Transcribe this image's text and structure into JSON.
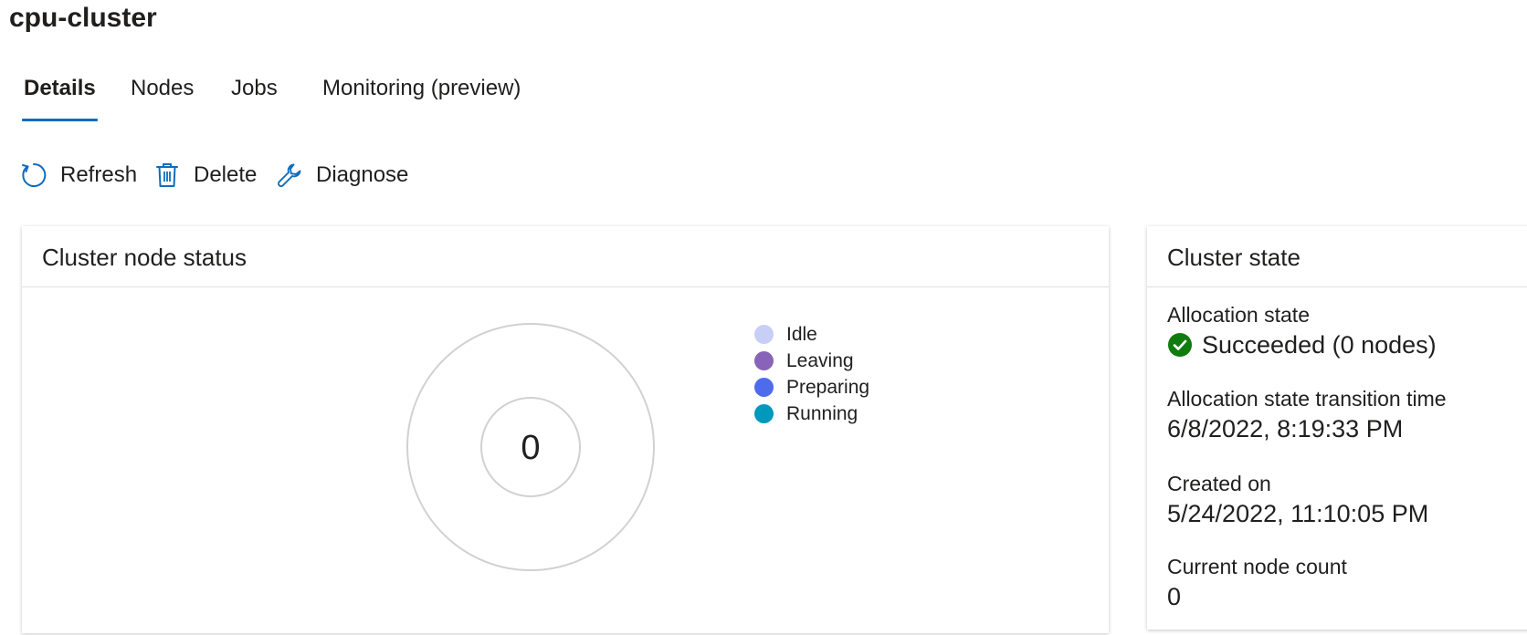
{
  "page": {
    "title": "cpu-cluster"
  },
  "tabs": [
    {
      "label": "Details",
      "active": true
    },
    {
      "label": "Nodes",
      "active": false
    },
    {
      "label": "Jobs",
      "active": false
    },
    {
      "label": "Monitoring (preview)",
      "active": false
    }
  ],
  "toolbar": {
    "refresh": {
      "label": "Refresh",
      "icon": "refresh-icon"
    },
    "delete": {
      "label": "Delete",
      "icon": "trash-icon"
    },
    "diagnose": {
      "label": "Diagnose",
      "icon": "wrench-icon"
    }
  },
  "node_status": {
    "title": "Cluster node status",
    "total": "0",
    "legend": [
      {
        "label": "Idle",
        "color": "#c7cff7"
      },
      {
        "label": "Leaving",
        "color": "#8764b8"
      },
      {
        "label": "Preparing",
        "color": "#4f6bed"
      },
      {
        "label": "Running",
        "color": "#0099bc"
      }
    ]
  },
  "chart_data": {
    "type": "pie",
    "categories": [
      "Idle",
      "Leaving",
      "Preparing",
      "Running"
    ],
    "values": [
      0,
      0,
      0,
      0
    ],
    "total": 0,
    "legend_position": "right"
  },
  "cluster_state": {
    "title": "Cluster state",
    "allocation_state": {
      "label": "Allocation state",
      "value": "Succeeded (0 nodes)",
      "status_color": "#107c10"
    },
    "transition_time": {
      "label": "Allocation state transition time",
      "value": "6/8/2022, 8:19:33 PM"
    },
    "created_on": {
      "label": "Created on",
      "value": "5/24/2022, 11:10:05 PM"
    },
    "node_count": {
      "label": "Current node count",
      "value": "0"
    }
  },
  "colors": {
    "accent": "#0f6cbd",
    "success": "#107c10",
    "ring": "#d1d1d1"
  }
}
